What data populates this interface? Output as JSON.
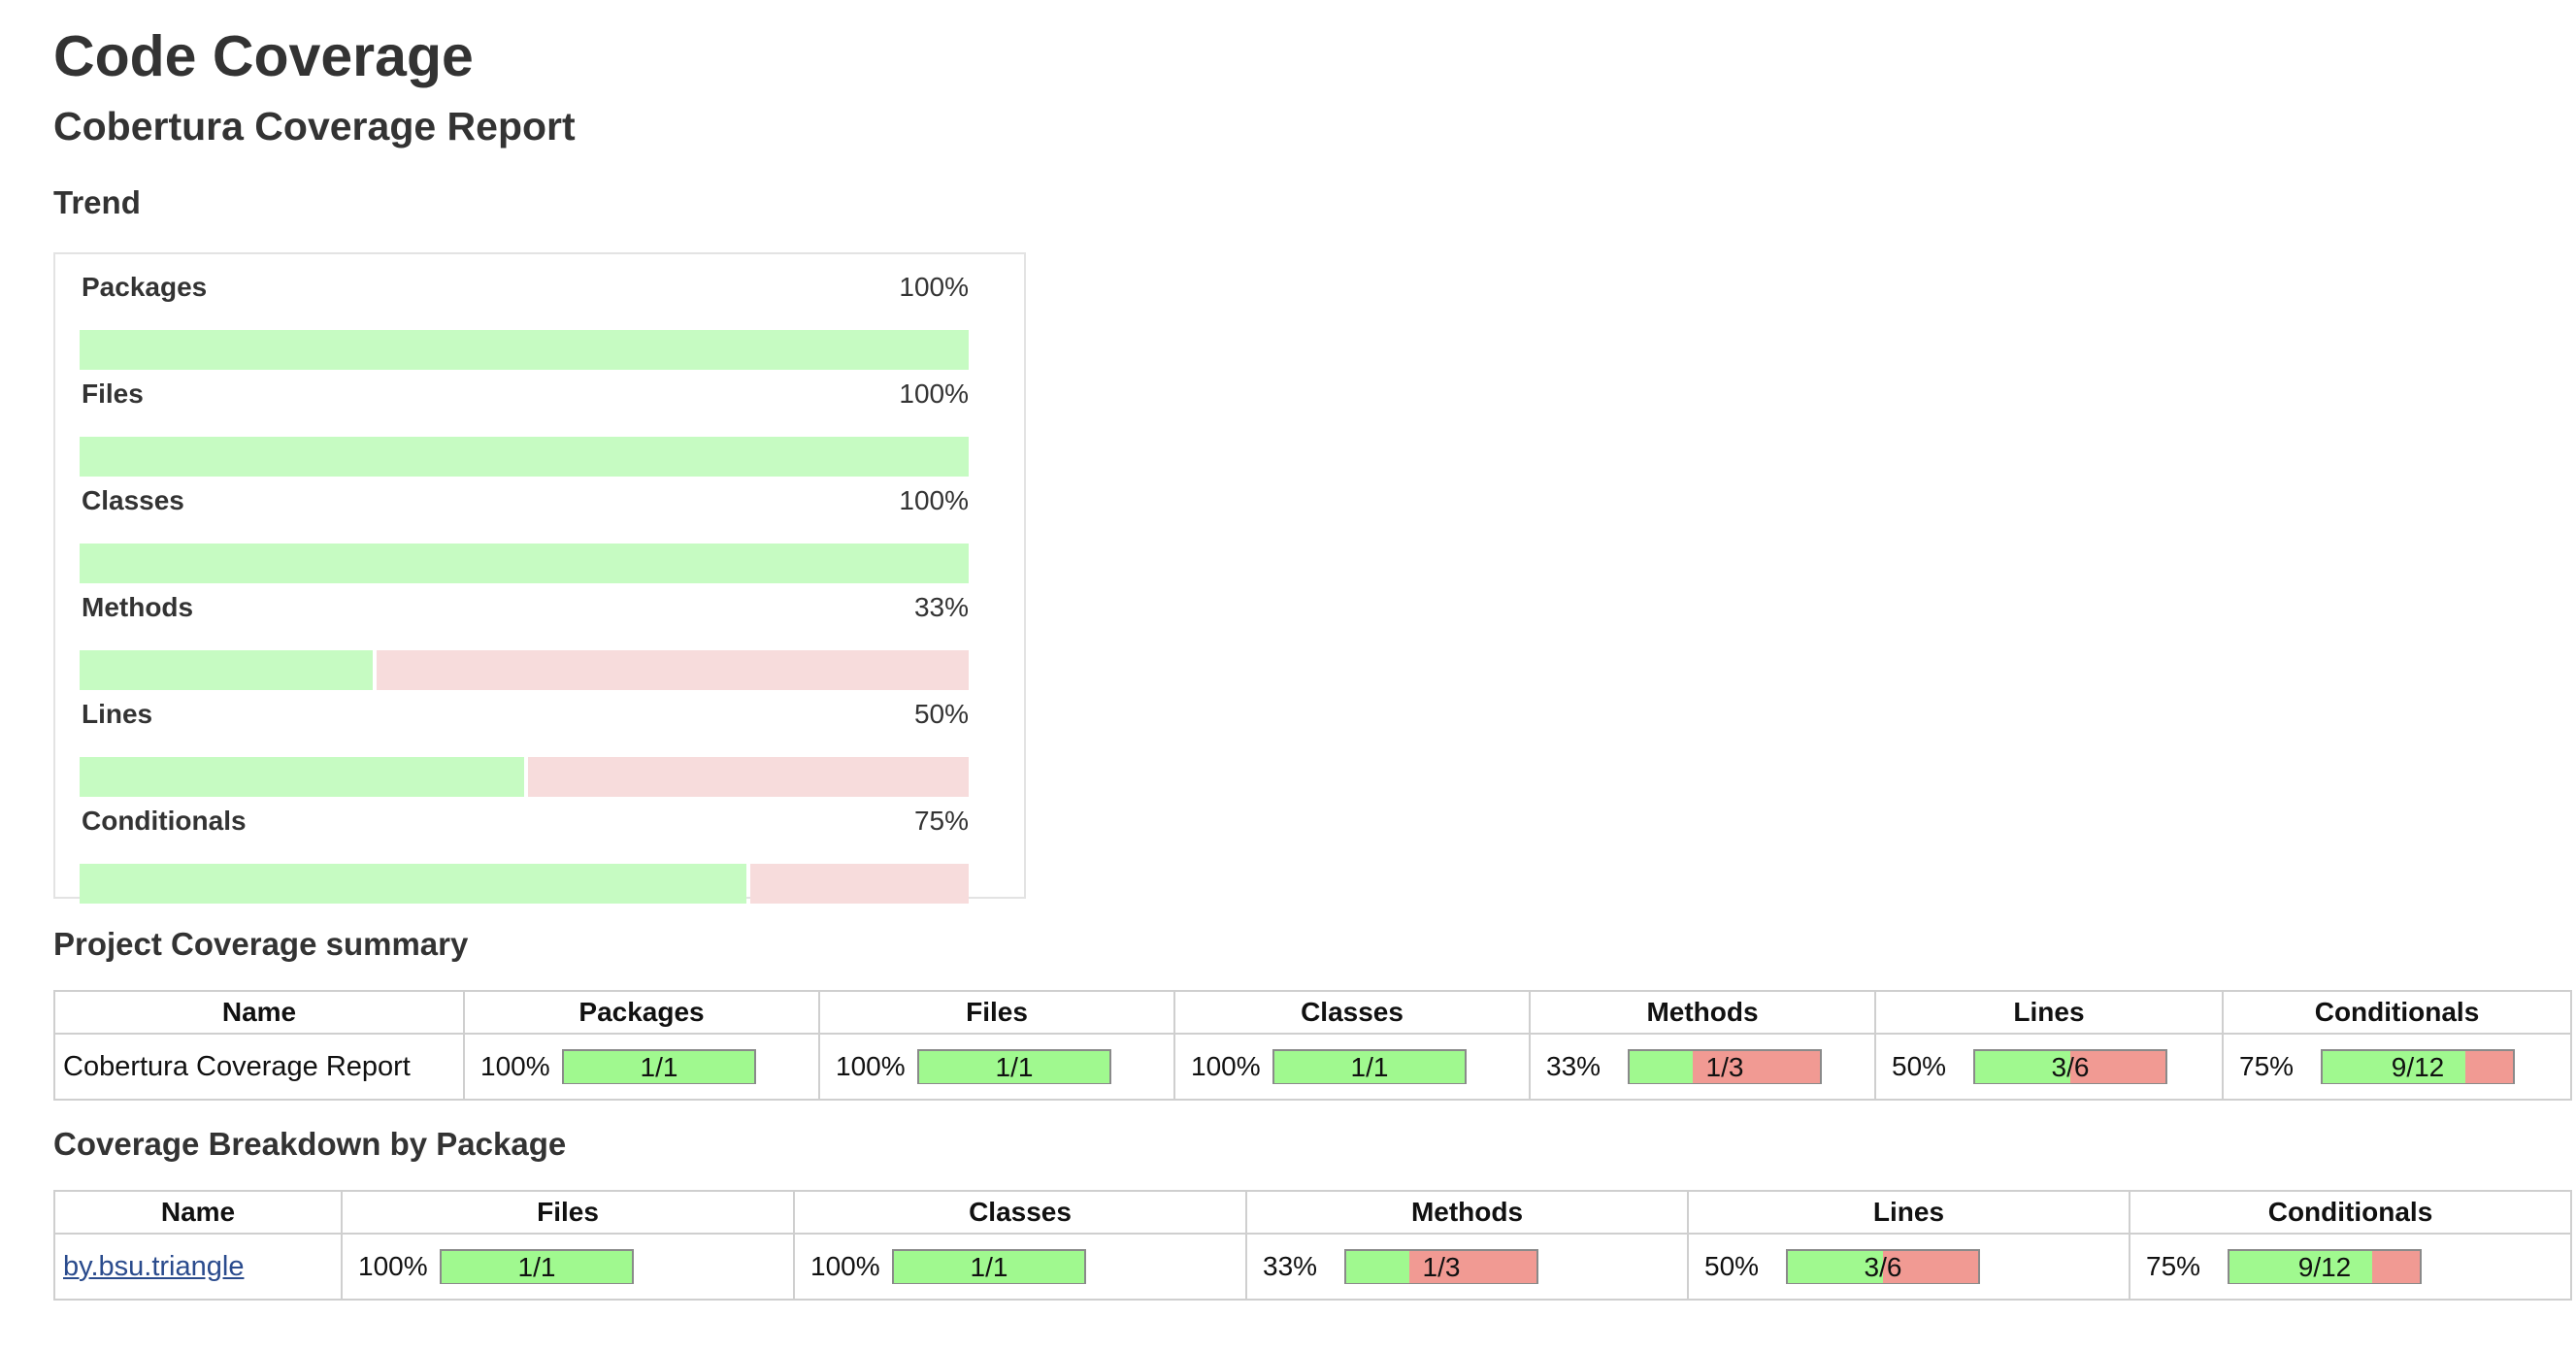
{
  "page": {
    "title": "Code Coverage",
    "subtitle": "Cobertura Coverage Report"
  },
  "trend": {
    "title": "Trend",
    "items": [
      {
        "label": "Packages",
        "percent_text": "100%",
        "percent": 100
      },
      {
        "label": "Files",
        "percent_text": "100%",
        "percent": 100
      },
      {
        "label": "Classes",
        "percent_text": "100%",
        "percent": 100
      },
      {
        "label": "Methods",
        "percent_text": "33%",
        "percent": 33
      },
      {
        "label": "Lines",
        "percent_text": "50%",
        "percent": 50
      },
      {
        "label": "Conditionals",
        "percent_text": "75%",
        "percent": 75
      }
    ]
  },
  "summary": {
    "title": "Project Coverage summary",
    "headers": [
      "Name",
      "Packages",
      "Files",
      "Classes",
      "Methods",
      "Lines",
      "Conditionals"
    ],
    "row": {
      "name": "Cobertura Coverage Report",
      "metrics": [
        {
          "percent_text": "100%",
          "ratio": "1/1",
          "fraction": 1.0
        },
        {
          "percent_text": "100%",
          "ratio": "1/1",
          "fraction": 1.0
        },
        {
          "percent_text": "100%",
          "ratio": "1/1",
          "fraction": 1.0
        },
        {
          "percent_text": "33%",
          "ratio": "1/3",
          "fraction": 0.33
        },
        {
          "percent_text": "50%",
          "ratio": "3/6",
          "fraction": 0.5
        },
        {
          "percent_text": "75%",
          "ratio": "9/12",
          "fraction": 0.75
        }
      ]
    }
  },
  "breakdown": {
    "title": "Coverage Breakdown by Package",
    "headers": [
      "Name",
      "Files",
      "Classes",
      "Methods",
      "Lines",
      "Conditionals"
    ],
    "row": {
      "name": "by.bsu.triangle",
      "metrics": [
        {
          "percent_text": "100%",
          "ratio": "1/1",
          "fraction": 1.0
        },
        {
          "percent_text": "100%",
          "ratio": "1/1",
          "fraction": 1.0
        },
        {
          "percent_text": "33%",
          "ratio": "1/3",
          "fraction": 0.33
        },
        {
          "percent_text": "50%",
          "ratio": "3/6",
          "fraction": 0.5
        },
        {
          "percent_text": "75%",
          "ratio": "9/12",
          "fraction": 0.75
        }
      ]
    }
  },
  "colors": {
    "trend_covered": "#c6fbc2",
    "trend_missed": "#f7dcdc",
    "bar_covered": "#a0f98f",
    "bar_missed": "#f19a93",
    "link": "#2a4b8d"
  }
}
